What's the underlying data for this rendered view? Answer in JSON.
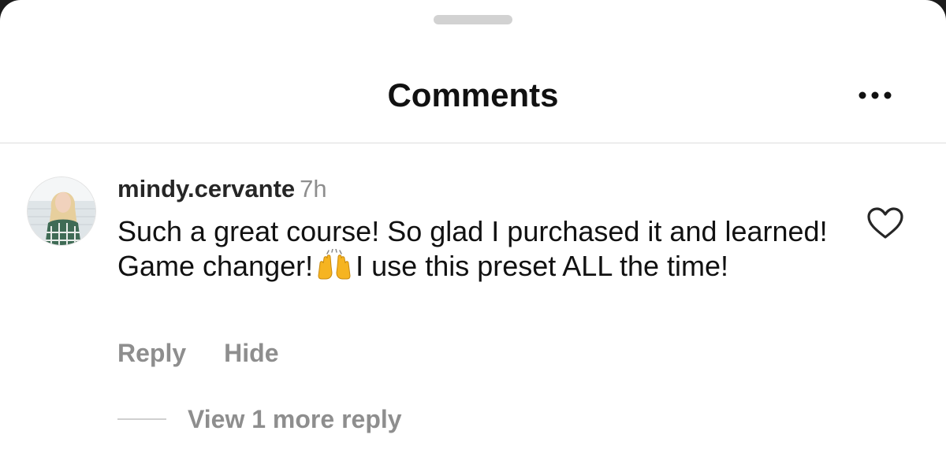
{
  "sheet": {
    "title": "Comments",
    "more_icon": "more-horizontal-icon"
  },
  "comment": {
    "username": "mindy.cervante",
    "timestamp": "7h",
    "text_before_emoji": "Such a great course! So glad I purchased it and learned! Game changer!",
    "emoji": "raising-hands-emoji",
    "text_after_emoji": "I use this preset ALL the time!",
    "like_icon": "heart-outline-icon",
    "actions": {
      "reply_label": "Reply",
      "hide_label": "Hide"
    },
    "view_replies_label": "View 1 more reply"
  },
  "colors": {
    "primary_text": "#111111",
    "secondary_text": "#8e8e8e",
    "divider": "#dcdcdc",
    "grabber": "#d2d2d2",
    "emoji_yellow": "#f6b421"
  }
}
